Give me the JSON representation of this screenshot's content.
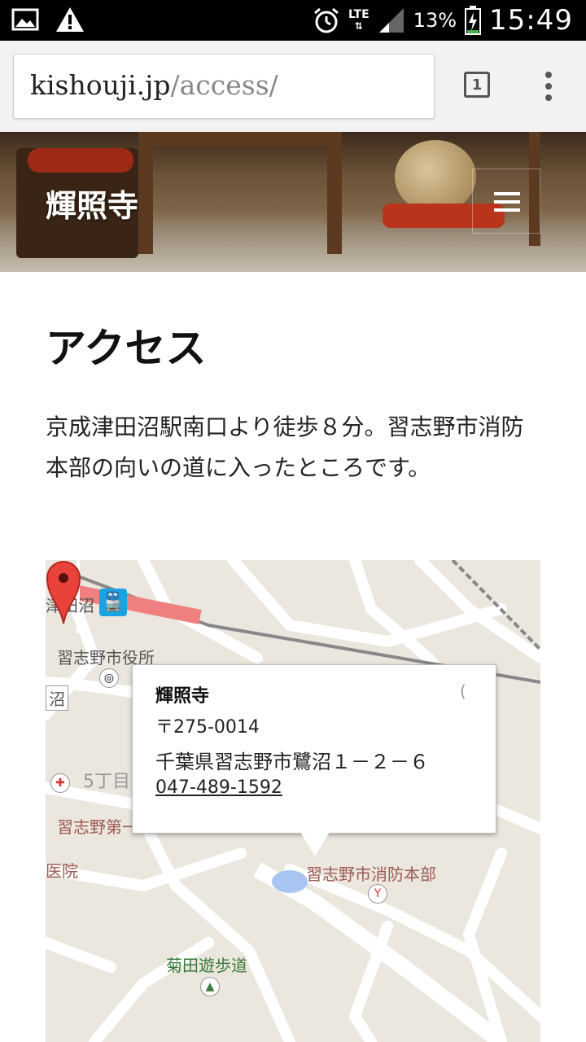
{
  "status_bar": {
    "battery": "13%",
    "time": "15:49",
    "network": "LTE",
    "icons": [
      "gallery-icon",
      "warning-icon",
      "alarm-icon",
      "lte-icon",
      "signal-icon",
      "battery-charging-icon"
    ]
  },
  "browser": {
    "url_domain": "kishouji.jp",
    "url_path": "/access/",
    "tab_count": "1"
  },
  "header": {
    "site_title": "輝照寺"
  },
  "main": {
    "title": "アクセス",
    "description": "京成津田沼駅南口より徒歩８分。習志野市消防本部の向いの道に入ったところです。"
  },
  "map": {
    "labels": {
      "station": "津田沼",
      "city_hall": "習志野市役所",
      "numa": "沼",
      "chome": "5丁目",
      "school": "習志野第一",
      "hospital": "医院",
      "fire_hq": "習志野市消防本部",
      "promenade": "菊田遊歩道"
    },
    "info": {
      "name": "輝照寺",
      "zip": "〒275-0014",
      "address": "千葉県習志野市鷺沼１－２－６",
      "tel": "047-489-1592"
    }
  }
}
